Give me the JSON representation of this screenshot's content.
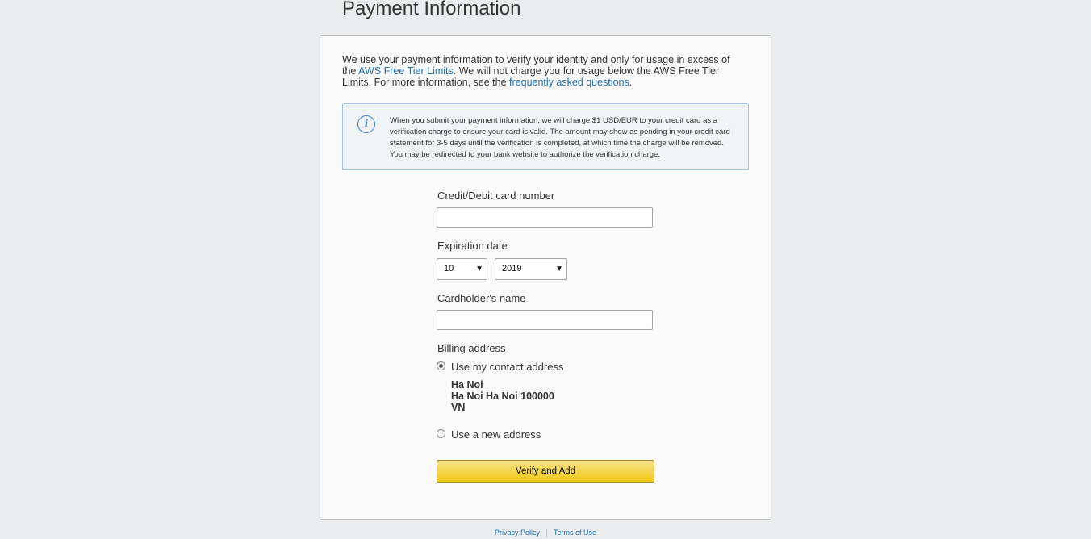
{
  "page": {
    "title": "Payment Information"
  },
  "intro": {
    "text_1": "We use your payment information to verify your identity and only for usage in excess of the ",
    "link_1": "AWS Free Tier Limits",
    "text_2": ". We will not charge you for usage below the AWS Free Tier Limits. For more information, see the ",
    "link_2": "frequently asked questions",
    "text_3": "."
  },
  "info_box": {
    "icon": "info-icon",
    "text": "When you submit your payment information, we will charge $1 USD/EUR to your credit card as a verification charge to ensure your card is valid. The amount may show as pending in your credit card statement for 3-5 days until the verification is completed, at which time the charge will be removed. You may be redirected to your bank website to authorize the verification charge."
  },
  "form": {
    "card_number_label": "Credit/Debit card number",
    "card_number_value": "",
    "expiration_label": "Expiration date",
    "exp_month": "10",
    "exp_year": "2019",
    "cardholder_label": "Cardholder's name",
    "cardholder_value": "",
    "billing_label": "Billing address",
    "option_contact": "Use my contact address",
    "option_contact_selected": true,
    "address_line_1": "Ha Noi",
    "address_line_2": "Ha Noi Ha Noi 100000",
    "address_line_3": "VN",
    "option_new": "Use a new address",
    "submit_label": "Verify and Add"
  },
  "footer": {
    "privacy": "Privacy Policy",
    "terms": "Terms of Use"
  },
  "colors": {
    "link": "#1f6fb2",
    "button": "#f0c916",
    "info_border": "#a9c6e1",
    "background": "#eaeded"
  }
}
